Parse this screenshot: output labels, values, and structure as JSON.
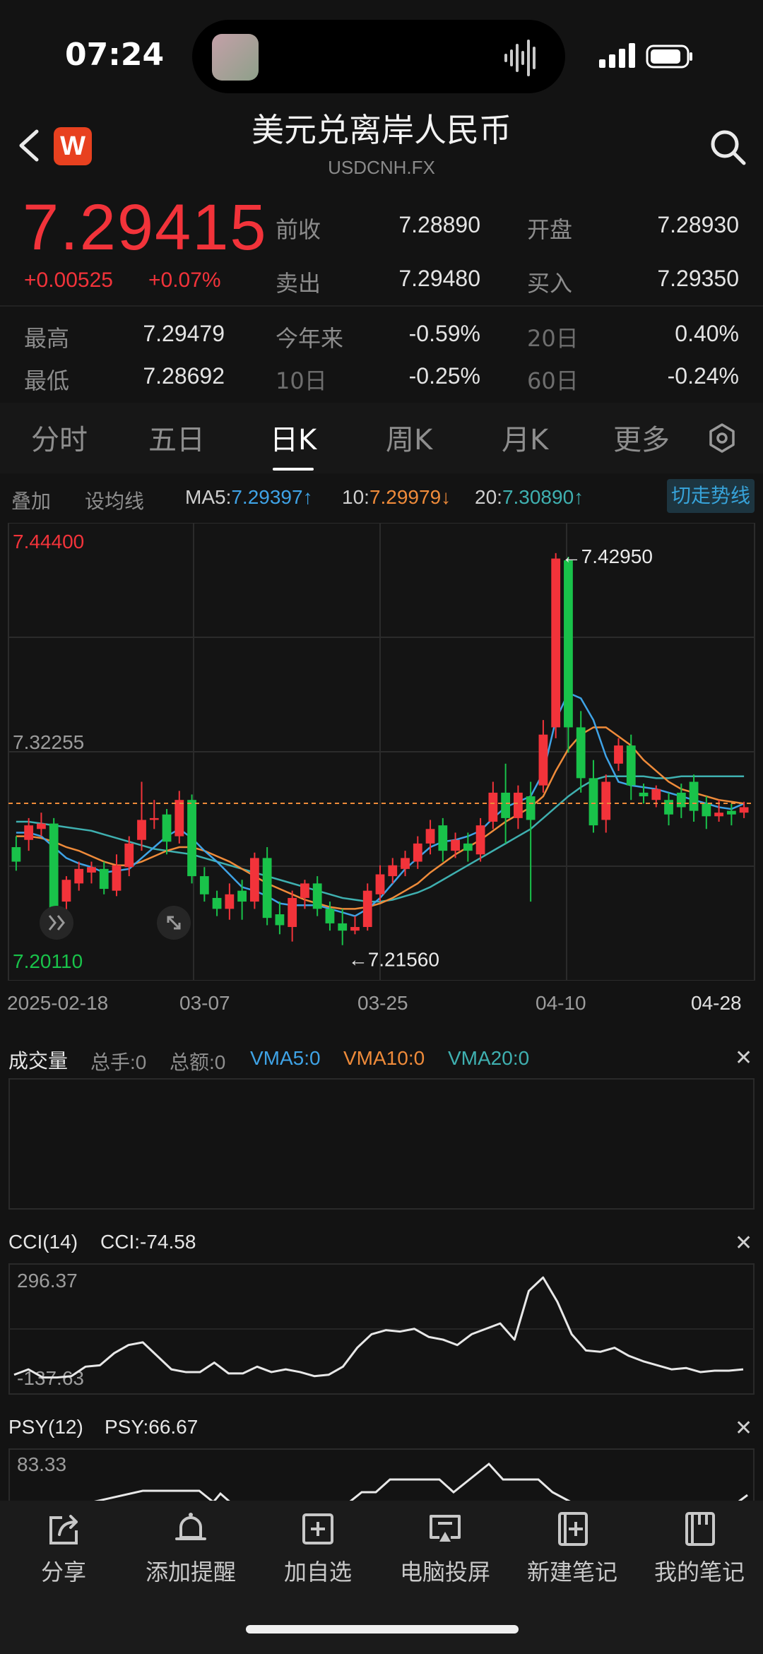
{
  "status": {
    "time": "07:24"
  },
  "header": {
    "title": "美元兑离岸人民币",
    "subtitle": "USDCNH.FX",
    "logo_letter": "W"
  },
  "quote": {
    "price": "7.29415",
    "change": "+0.00525",
    "change_pct": "+0.07%",
    "rows": [
      {
        "label": "前收",
        "value": "7.28890",
        "label2": "开盘",
        "value2": "7.28930"
      },
      {
        "label": "卖出",
        "value": "7.29480",
        "label2": "买入",
        "value2": "7.29350"
      }
    ],
    "stats": [
      {
        "label": "最高",
        "value": "7.29479",
        "label2": "今年来",
        "value2": "-0.59%",
        "label3": "20日",
        "value3": "0.40%"
      },
      {
        "label": "最低",
        "value": "7.28692",
        "label2": "10日",
        "value2": "-0.25%",
        "label3": "60日",
        "value3": "-0.24%"
      }
    ]
  },
  "tabs": [
    "分时",
    "五日",
    "日K",
    "周K",
    "月K",
    "更多"
  ],
  "active_tab": "日K",
  "ma": {
    "overlay": "叠加",
    "set_ma": "设均线",
    "ma5_label": "MA5:",
    "ma5": "7.29397",
    "ma10_label": "10:",
    "ma10": "7.29979",
    "ma20_label": "20:",
    "ma20": "7.30890",
    "up_arrow": "↑",
    "down_arrow": "↓",
    "switch": "切走势线"
  },
  "colors": {
    "up": "#f2333a",
    "down": "#19c24a",
    "ma5": "#3fa3e6",
    "ma10": "#ef8b3a",
    "ma20": "#3fb0b0",
    "price_line": "#ef8b3a"
  },
  "chart_data": {
    "type": "candlestick",
    "y_top_label": "7.44400",
    "y_mid_label": "7.32255",
    "y_bottom_label": "7.20110",
    "ylim": [
      7.2011,
      7.444
    ],
    "x_tick_labels": [
      "2025-02-18",
      "03-07",
      "03-25",
      "04-10",
      "04-28"
    ],
    "max_annotation": "7.42950",
    "min_annotation": "7.21560",
    "candles": [
      [
        7.27,
        7.262,
        7.276,
        7.257
      ],
      [
        7.274,
        7.282,
        7.286,
        7.268
      ],
      [
        7.28,
        7.283,
        7.289,
        7.276
      ],
      [
        7.283,
        7.236,
        7.286,
        7.232
      ],
      [
        7.24,
        7.252,
        7.254,
        7.23
      ],
      [
        7.25,
        7.258,
        7.262,
        7.246
      ],
      [
        7.256,
        7.259,
        7.262,
        7.25
      ],
      [
        7.258,
        7.247,
        7.262,
        7.244
      ],
      [
        7.246,
        7.26,
        7.266,
        7.243
      ],
      [
        7.259,
        7.272,
        7.276,
        7.254
      ],
      [
        7.274,
        7.285,
        7.306,
        7.268
      ],
      [
        7.285,
        7.286,
        7.296,
        7.28
      ],
      [
        7.288,
        7.273,
        7.291,
        7.266
      ],
      [
        7.276,
        7.296,
        7.301,
        7.272
      ],
      [
        7.296,
        7.254,
        7.299,
        7.25
      ],
      [
        7.254,
        7.244,
        7.259,
        7.24
      ],
      [
        7.242,
        7.236,
        7.246,
        7.232
      ],
      [
        7.236,
        7.244,
        7.25,
        7.23
      ],
      [
        7.246,
        7.24,
        7.252,
        7.23
      ],
      [
        7.24,
        7.264,
        7.267,
        7.236
      ],
      [
        7.264,
        7.231,
        7.27,
        7.227
      ],
      [
        7.233,
        7.227,
        7.24,
        7.222
      ],
      [
        7.226,
        7.242,
        7.246,
        7.218
      ],
      [
        7.242,
        7.25,
        7.252,
        7.236
      ],
      [
        7.25,
        7.236,
        7.254,
        7.232
      ],
      [
        7.236,
        7.228,
        7.24,
        7.224
      ],
      [
        7.228,
        7.224,
        7.236,
        7.216
      ],
      [
        7.224,
        7.226,
        7.232,
        7.222
      ],
      [
        7.226,
        7.246,
        7.25,
        7.224
      ],
      [
        7.244,
        7.255,
        7.26,
        7.24
      ],
      [
        7.254,
        7.26,
        7.264,
        7.25
      ],
      [
        7.258,
        7.264,
        7.268,
        7.254
      ],
      [
        7.262,
        7.272,
        7.276,
        7.258
      ],
      [
        7.272,
        7.28,
        7.285,
        7.266
      ],
      [
        7.282,
        7.268,
        7.286,
        7.262
      ],
      [
        7.268,
        7.274,
        7.278,
        7.264
      ],
      [
        7.272,
        7.268,
        7.278,
        7.262
      ],
      [
        7.266,
        7.282,
        7.286,
        7.262
      ],
      [
        7.284,
        7.3,
        7.306,
        7.28
      ],
      [
        7.3,
        7.286,
        7.316,
        7.272
      ],
      [
        7.286,
        7.3,
        7.304,
        7.28
      ],
      [
        7.298,
        7.285,
        7.306,
        7.24
      ],
      [
        7.304,
        7.332,
        7.34,
        7.3
      ],
      [
        7.336,
        7.429,
        7.432,
        7.33
      ],
      [
        7.428,
        7.336,
        7.43,
        7.322
      ],
      [
        7.336,
        7.308,
        7.345,
        7.3
      ],
      [
        7.308,
        7.282,
        7.318,
        7.278
      ],
      [
        7.285,
        7.306,
        7.31,
        7.278
      ],
      [
        7.316,
        7.326,
        7.33,
        7.312
      ],
      [
        7.326,
        7.304,
        7.332,
        7.296
      ],
      [
        7.3,
        7.298,
        7.305,
        7.294
      ],
      [
        7.296,
        7.302,
        7.304,
        7.292
      ],
      [
        7.296,
        7.288,
        7.3,
        7.282
      ],
      [
        7.3,
        7.292,
        7.305,
        7.286
      ],
      [
        7.306,
        7.29,
        7.31,
        7.284
      ],
      [
        7.294,
        7.287,
        7.298,
        7.28
      ],
      [
        7.287,
        7.289,
        7.296,
        7.284
      ],
      [
        7.29,
        7.288,
        7.294,
        7.282
      ],
      [
        7.289,
        7.292,
        7.295,
        7.286
      ]
    ],
    "ma5": [
      7.278,
      7.278,
      7.276,
      7.27,
      7.264,
      7.261,
      7.259,
      7.256,
      7.257,
      7.258,
      7.264,
      7.27,
      7.276,
      7.28,
      7.275,
      7.268,
      7.262,
      7.255,
      7.248,
      7.246,
      7.243,
      7.239,
      7.238,
      7.238,
      7.238,
      7.236,
      7.234,
      7.232,
      7.236,
      7.242,
      7.25,
      7.258,
      7.264,
      7.27,
      7.273,
      7.274,
      7.276,
      7.279,
      7.286,
      7.292,
      7.295,
      7.298,
      7.311,
      7.34,
      7.355,
      7.352,
      7.34,
      7.32,
      7.306,
      7.304,
      7.303,
      7.302,
      7.3,
      7.298,
      7.296,
      7.294,
      7.292,
      7.291,
      7.294
    ],
    "ma10": [
      7.276,
      7.276,
      7.275,
      7.273,
      7.27,
      7.268,
      7.265,
      7.262,
      7.26,
      7.26,
      7.262,
      7.265,
      7.268,
      7.27,
      7.27,
      7.268,
      7.265,
      7.262,
      7.258,
      7.254,
      7.25,
      7.247,
      7.244,
      7.241,
      7.239,
      7.237,
      7.236,
      7.236,
      7.237,
      7.239,
      7.242,
      7.246,
      7.25,
      7.256,
      7.261,
      7.266,
      7.27,
      7.274,
      7.279,
      7.284,
      7.288,
      7.292,
      7.298,
      7.312,
      7.324,
      7.332,
      7.336,
      7.336,
      7.331,
      7.326,
      7.318,
      7.312,
      7.306,
      7.302,
      7.3,
      7.298,
      7.296,
      7.295,
      7.294
    ],
    "ma20": [
      7.284,
      7.284,
      7.283,
      7.282,
      7.281,
      7.28,
      7.279,
      7.277,
      7.275,
      7.273,
      7.271,
      7.269,
      7.268,
      7.267,
      7.266,
      7.264,
      7.262,
      7.26,
      7.258,
      7.256,
      7.254,
      7.252,
      7.25,
      7.248,
      7.246,
      7.244,
      7.242,
      7.241,
      7.24,
      7.24,
      7.241,
      7.243,
      7.245,
      7.248,
      7.252,
      7.256,
      7.26,
      7.264,
      7.268,
      7.272,
      7.276,
      7.28,
      7.286,
      7.292,
      7.298,
      7.303,
      7.307,
      7.309,
      7.309,
      7.309,
      7.309,
      7.308,
      7.308,
      7.309,
      7.309,
      7.309,
      7.309,
      7.309,
      7.309
    ],
    "current_price": 7.29415
  },
  "volume_panel": {
    "title": "成交量",
    "total_hands": "总手:0",
    "total_amount": "总额:0",
    "vma5": "VMA5:0",
    "vma10": "VMA10:0",
    "vma20": "VMA20:0",
    "close": "✕"
  },
  "cci_panel": {
    "title": "CCI(14)",
    "value": "CCI:-74.58",
    "top_label": "296.37",
    "bottom_label": "-137.63",
    "close": "✕",
    "values": [
      -90,
      -70,
      -100,
      -100,
      -95,
      -60,
      -55,
      -10,
      20,
      30,
      -20,
      -70,
      -80,
      -80,
      -45,
      -85,
      -85,
      -60,
      -80,
      -70,
      -80,
      -95,
      -90,
      -60,
      10,
      60,
      75,
      70,
      80,
      50,
      40,
      20,
      60,
      80,
      100,
      40,
      220,
      270,
      180,
      60,
      0,
      -5,
      10,
      -20,
      -40,
      -55,
      -70,
      -65,
      -80,
      -75,
      -75,
      -70
    ]
  },
  "psy_panel": {
    "title": "PSY(12)",
    "value": "PSY:66.67",
    "top_label": "83.33",
    "close": "✕"
  },
  "bottom_nav": [
    {
      "label": "分享",
      "icon": "share-icon"
    },
    {
      "label": "添加提醒",
      "icon": "bell-icon"
    },
    {
      "label": "加自选",
      "icon": "add-square-icon"
    },
    {
      "label": "电脑投屏",
      "icon": "cast-icon"
    },
    {
      "label": "新建笔记",
      "icon": "new-note-icon"
    },
    {
      "label": "我的笔记",
      "icon": "notebook-icon"
    }
  ]
}
